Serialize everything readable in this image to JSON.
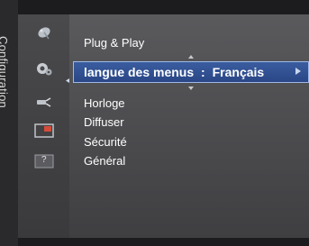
{
  "sidebar": {
    "tab_label": "Configuration",
    "icons": [
      "satellite-dish-icon",
      "gear-settings-icon",
      "input-plug-icon",
      "picture-in-picture-icon",
      "help-icon"
    ],
    "help_text": "?"
  },
  "menu": {
    "items": [
      {
        "label": "Plug & Play"
      },
      {
        "label": "langue des menus",
        "value": "Français",
        "separator": ":",
        "active": true
      },
      {
        "label": "Horloge"
      },
      {
        "label": "Diffuser"
      },
      {
        "label": "Sécurité"
      },
      {
        "label": "Général"
      }
    ]
  },
  "colors": {
    "highlight": "#2f4d8f",
    "highlight_border": "#9fb8e6",
    "panel": "#4c4c4f",
    "background": "#1c1c1e"
  }
}
